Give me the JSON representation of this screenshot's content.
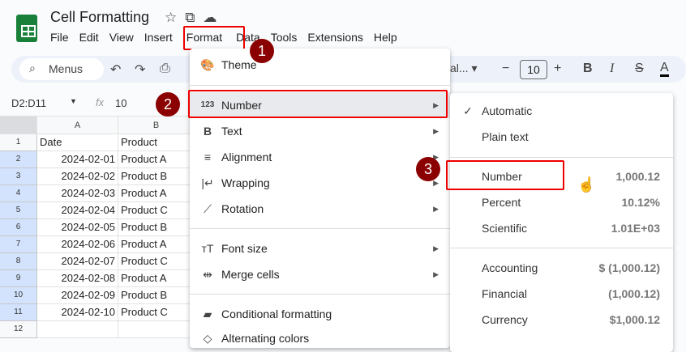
{
  "doc": {
    "title": "Cell Formatting"
  },
  "menubar": [
    "File",
    "Edit",
    "View",
    "Insert",
    "Format",
    "Data",
    "Tools",
    "Extensions",
    "Help"
  ],
  "toolbar": {
    "search": "Menus",
    "font": "al...",
    "font_size": "10"
  },
  "formula_bar": {
    "range": "D2:D11",
    "fx": "fx",
    "value": "10"
  },
  "sheet": {
    "columns": [
      "A",
      "B"
    ],
    "rows": [
      [
        "1",
        "Date",
        "Product"
      ],
      [
        "2",
        "2024-02-01",
        "Product A"
      ],
      [
        "3",
        "2024-02-02",
        "Product B"
      ],
      [
        "4",
        "2024-02-03",
        "Product A"
      ],
      [
        "5",
        "2024-02-04",
        "Product C"
      ],
      [
        "6",
        "2024-02-05",
        "Product B"
      ],
      [
        "7",
        "2024-02-06",
        "Product A"
      ],
      [
        "8",
        "2024-02-07",
        "Product C"
      ],
      [
        "9",
        "2024-02-08",
        "Product A"
      ],
      [
        "10",
        "2024-02-09",
        "Product B"
      ],
      [
        "11",
        "2024-02-10",
        "Product C"
      ],
      [
        "12",
        "",
        ""
      ]
    ]
  },
  "format_menu": [
    {
      "label": "Theme",
      "icon": "palette-icon"
    },
    {
      "label": "Number",
      "icon": "123-icon",
      "sub": true
    },
    {
      "label": "Text",
      "icon": "bold-icon",
      "sub": true
    },
    {
      "label": "Alignment",
      "icon": "align-icon",
      "sub": true
    },
    {
      "label": "Wrapping",
      "icon": "wrap-icon",
      "sub": true
    },
    {
      "label": "Rotation",
      "icon": "rotate-icon",
      "sub": true
    },
    {
      "label": "Font size",
      "icon": "font-size-icon",
      "sub": true
    },
    {
      "label": "Merge cells",
      "icon": "merge-icon",
      "sub": true
    },
    {
      "label": "Conditional formatting",
      "icon": "conditional-icon"
    },
    {
      "label": "Alternating colors",
      "icon": "alternating-icon"
    }
  ],
  "number_menu": [
    {
      "label": "Automatic",
      "value": "",
      "checked": true
    },
    {
      "label": "Plain text",
      "value": ""
    },
    {
      "label": "Number",
      "value": "1,000.12"
    },
    {
      "label": "Percent",
      "value": "10.12%"
    },
    {
      "label": "Scientific",
      "value": "1.01E+03"
    },
    {
      "label": "Accounting",
      "value": "$ (1,000.12)"
    },
    {
      "label": "Financial",
      "value": "(1,000.12)"
    },
    {
      "label": "Currency",
      "value": "$1,000.12"
    }
  ],
  "badges": [
    "1",
    "2",
    "3"
  ],
  "colors": {
    "badge": "#8b0000",
    "highlight": "#e00000"
  }
}
